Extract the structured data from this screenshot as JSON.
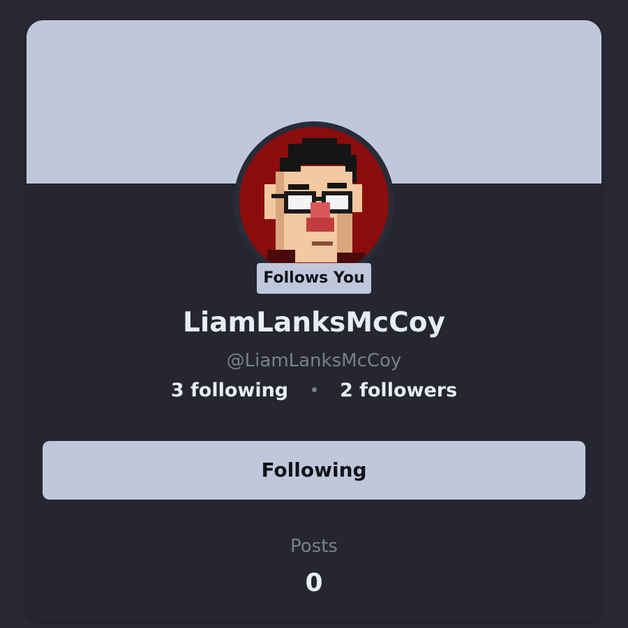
{
  "profile": {
    "follows_you_badge": "Follows You",
    "display_name": "LiamLanksMcCoy",
    "handle": "@LiamLanksMcCoy",
    "following_text": "3 following",
    "followers_text": "2 followers",
    "follow_button_label": "Following",
    "posts_label": "Posts",
    "posts_count": "0",
    "avatar_icon": "pixel-art-face-avatar"
  },
  "colors": {
    "background": "#272833",
    "card": "#252631",
    "banner": "#bfc8da",
    "avatar_bg": "#8a0d0d",
    "text_primary": "#e8ecf4",
    "text_muted": "#7c7f8a",
    "button_bg": "#bfc8da",
    "button_text": "#111318"
  }
}
